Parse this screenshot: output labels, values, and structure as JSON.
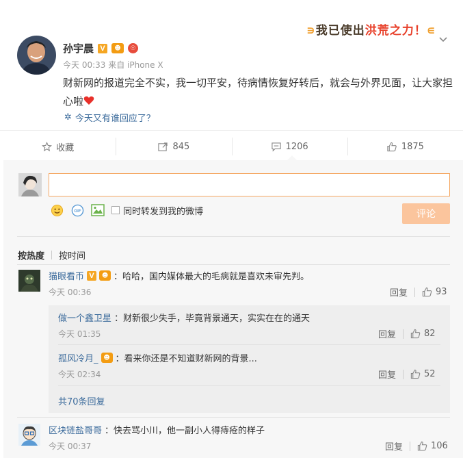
{
  "post": {
    "author": "孙宇晨",
    "meta": "今天 00:33 来自 iPhone X",
    "content": "财新网的报道完全不实，我一切平安，待病情恢复好转后，就会与外界见面，让大家担心啦",
    "topic": "今天又有谁回应了？",
    "banner_text_a": "我已使出",
    "banner_text_b": "洪荒",
    "banner_text_c": "之力！"
  },
  "actions": {
    "favorite_label": "收藏",
    "repost_count": "845",
    "comment_count": "1206",
    "like_count": "1875"
  },
  "composer": {
    "repost_checkbox_label": "同时转发到我的微博",
    "submit_label": "评论"
  },
  "sort": {
    "by_hot": "按热度",
    "by_time": "按时间"
  },
  "comments": [
    {
      "user": "猫眼看币",
      "text": "：哈哈，国内媒体最大的毛病就是喜欢未审先判。",
      "time": "今天 00:36",
      "reply_label": "回复",
      "likes": "93"
    },
    {
      "user": "区块链盐哥哥",
      "text": "：快去骂小川，他一副小人得痔疮的样子",
      "time": "今天 00:37",
      "reply_label": "回复",
      "likes": "106"
    }
  ],
  "replies": [
    {
      "user": "做一个鑫卫星",
      "text": "：财新很少失手，毕竟背景通天，实实在在的通天",
      "time": "今天 01:35",
      "reply_label": "回复",
      "likes": "82"
    },
    {
      "user": "孤风冷月_",
      "text": "：看来你还是不知道财新网的背景...",
      "time": "今天 02:34",
      "reply_label": "回复",
      "likes": "52"
    }
  ],
  "more_replies": "共70条回复",
  "colors": {
    "link": "#3a6a9b",
    "accent": "#f5a55f",
    "heart": "#e8302a"
  }
}
